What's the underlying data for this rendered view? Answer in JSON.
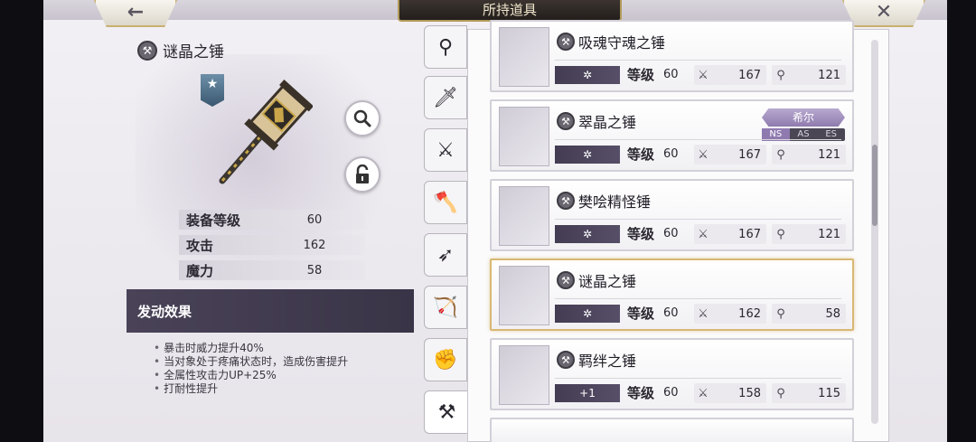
{
  "header": {
    "title": "所持道具",
    "back_icon": "←",
    "close_icon": "✕"
  },
  "detail": {
    "name": "谜晶之锤",
    "stats": [
      {
        "label": "装备等级",
        "value": "60"
      },
      {
        "label": "攻击",
        "value": "162"
      },
      {
        "label": "魔力",
        "value": "58"
      }
    ],
    "effect_title": "发动效果",
    "effects": [
      "暴击时威力提升40%",
      "当对象处于疼痛状态时，造成伤害提升",
      "全属性攻击力UP+25%",
      "打耐性提升"
    ]
  },
  "tabs": [
    {
      "icon": "staff-icon"
    },
    {
      "icon": "sword-icon"
    },
    {
      "icon": "katana-icon"
    },
    {
      "icon": "axe-icon"
    },
    {
      "icon": "spear-icon"
    },
    {
      "icon": "bow-icon"
    },
    {
      "icon": "fist-icon"
    },
    {
      "icon": "hammer-icon"
    }
  ],
  "list": {
    "level_label": "等级",
    "items": [
      {
        "name": "吸魂守魂之锤",
        "slot": "✲",
        "level": "60",
        "atk": "167",
        "mag": "121"
      },
      {
        "name": "翠晶之锤",
        "slot": "✲",
        "level": "60",
        "atk": "167",
        "mag": "121",
        "character": "希尔",
        "char_tags": [
          "NS",
          "AS",
          "ES"
        ]
      },
      {
        "name": "樊哙精怪锤",
        "slot": "✲",
        "level": "60",
        "atk": "167",
        "mag": "121"
      },
      {
        "name": "谜晶之锤",
        "slot": "✲",
        "level": "60",
        "atk": "162",
        "mag": "58",
        "selected": true
      },
      {
        "name": "羁绊之锤",
        "slot": "+1",
        "level": "60",
        "atk": "158",
        "mag": "115"
      }
    ]
  },
  "colors": {
    "accent_gold": "#d8b873",
    "panel_dark": "#433c52",
    "char_tag": "#8e7bad"
  }
}
